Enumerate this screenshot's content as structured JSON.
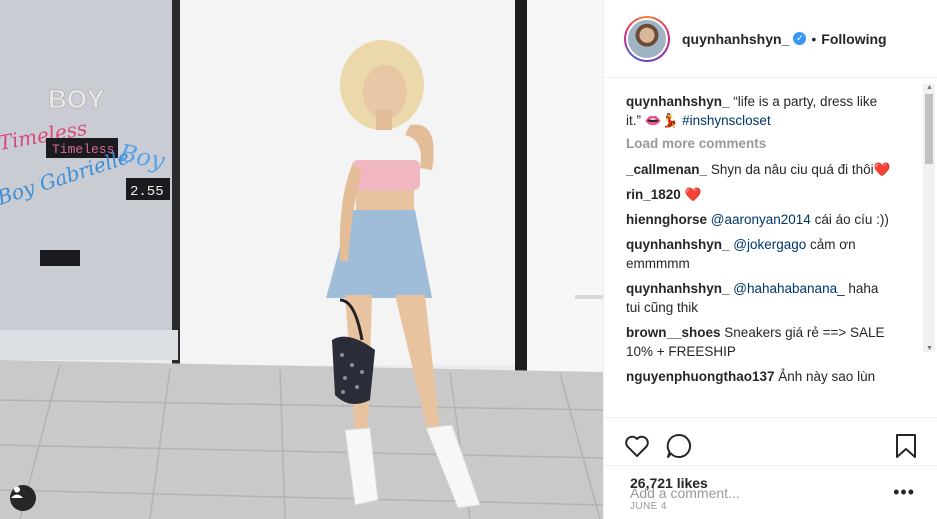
{
  "post": {
    "username": "quynhanhshyn_",
    "verified_mark": "✓",
    "separator": "•",
    "follow_status": "Following"
  },
  "caption": {
    "username": "quynhanhshyn_",
    "text": "“life is a party, dress like it.” 👄💃",
    "hashtag": "#inshynscloset"
  },
  "load_more": "Load more comments",
  "comments": [
    {
      "user": "_callmenan_",
      "mention": "",
      "text": "Shyn da nâu ciu quá đi thôi❤️"
    },
    {
      "user": "rin_1820",
      "mention": "",
      "text": "❤️"
    },
    {
      "user": "hiennghorse",
      "mention": "@aaronyan2014",
      "text": "cái áo cíu :))"
    },
    {
      "user": "quynhanhshyn_",
      "mention": "@jokergago",
      "text": "cảm ơn emmmmm"
    },
    {
      "user": "quynhanhshyn_",
      "mention": "@hahahabanana_",
      "text": "haha tui cũng thik"
    },
    {
      "user": "brown__shoes",
      "mention": "",
      "text": "Sneakers giá rẻ ==> SALE 10% + FREESHIP"
    },
    {
      "user": "nguyenphuongthao137",
      "mention": "",
      "text": "Ảnh này sao lùn"
    }
  ],
  "likes": "26,721 likes",
  "date": "JUNE 4",
  "add_comment_placeholder": "Add a comment...",
  "more_options": "•••",
  "icons": {
    "like": "heart-icon",
    "comment": "comment-bubble-icon",
    "save": "bookmark-icon",
    "tagged": "person-tag-icon"
  },
  "photo_signage": {
    "boy_sign": "BOY",
    "timeless": "Timeless",
    "timeless_box": "Timeless",
    "boy_neon": "Boy",
    "boy_gabrielle": "Boy Gabrielle",
    "price": "2.55"
  },
  "colors": {
    "link": "#003569",
    "muted": "#999999",
    "verified": "#3897f0",
    "heart": "#ed4956"
  }
}
